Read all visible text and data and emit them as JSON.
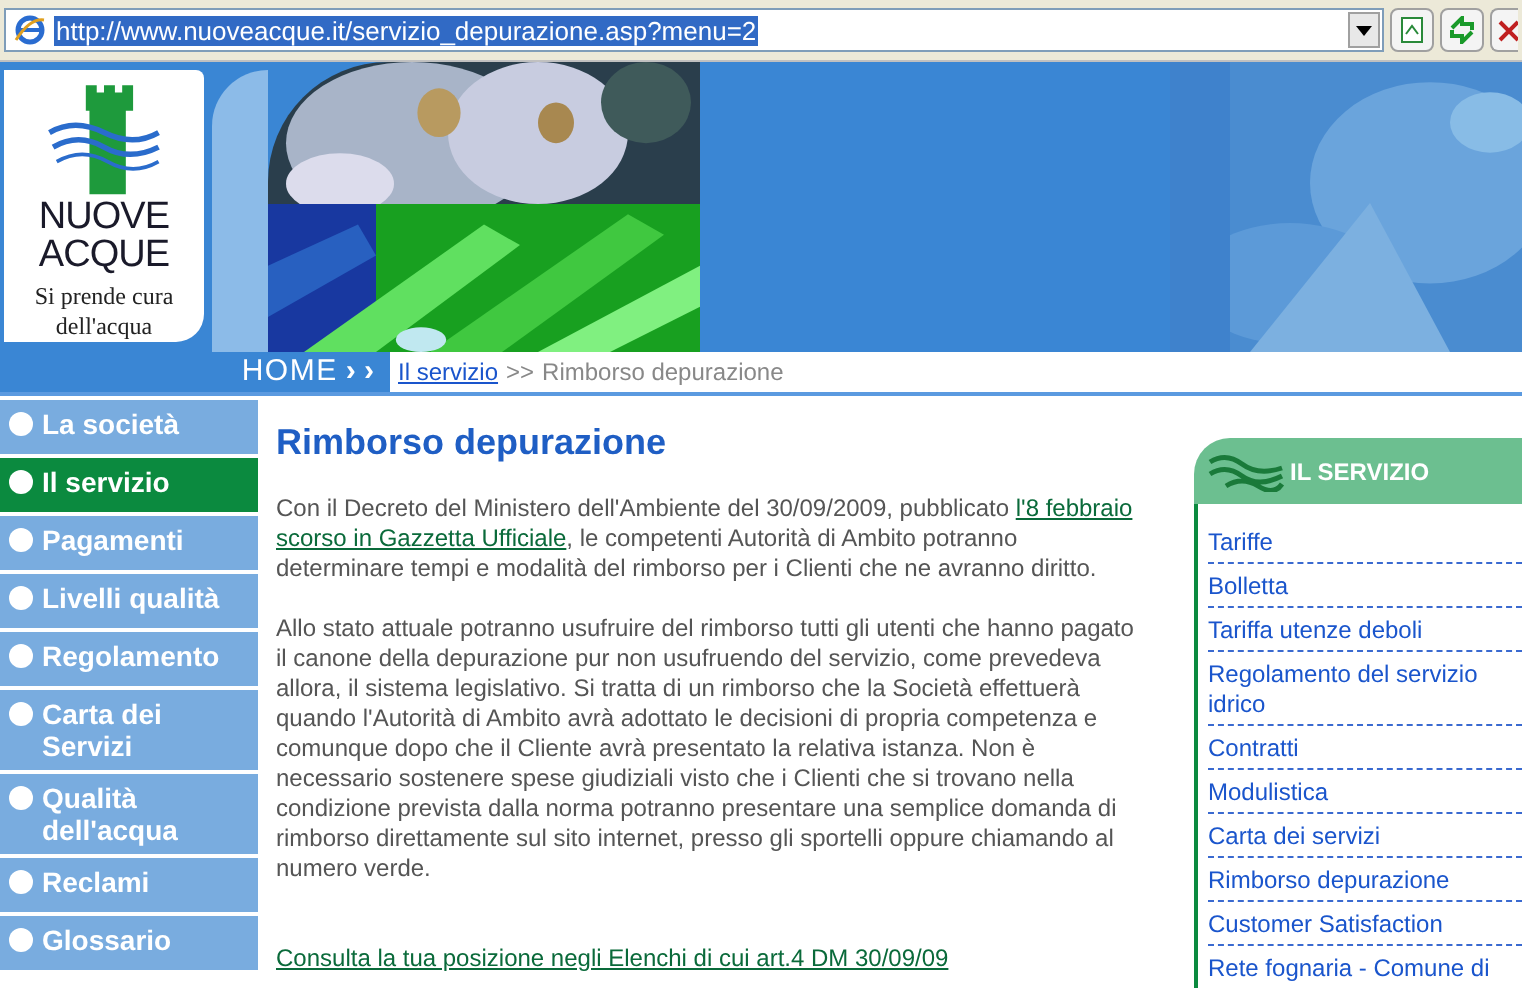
{
  "address_bar": {
    "url": "http://www.nuoveacque.it/servizio_depurazione.asp?menu=2"
  },
  "logo": {
    "name_lines": [
      "NUOVE",
      "ACQUE"
    ],
    "tagline_lines": [
      "Si prende cura",
      "dell'acqua"
    ]
  },
  "home_bar": {
    "label": "HOME",
    "arrows": "› ›"
  },
  "breadcrumb": {
    "link": "Il servizio",
    "separator": ">>",
    "current": "Rimborso depurazione"
  },
  "sidebar": {
    "items": [
      {
        "label": "La società",
        "selected": false
      },
      {
        "label": "Il servizio",
        "selected": true
      },
      {
        "label": "Pagamenti",
        "selected": false
      },
      {
        "label": "Livelli qualità",
        "selected": false
      },
      {
        "label": "Regolamento",
        "selected": false
      },
      {
        "label": "Carta dei Servizi",
        "selected": false
      },
      {
        "label": "Qualità dell'acqua",
        "selected": false
      },
      {
        "label": "Reclami",
        "selected": false
      },
      {
        "label": "Glossario",
        "selected": false
      }
    ]
  },
  "main": {
    "title": "Rimborso depurazione",
    "paragraph_1": {
      "before": "Con il Decreto del Ministero dell'Ambiente del 30/09/2009, pubblicato",
      "link_lines": [
        "l'8 febbraio",
        "scorso in Gazzetta Ufficiale"
      ],
      "after": ", le competenti Autorità di Ambito potranno determinare tempi e modalità del rimborso per i Clienti che ne avranno diritto."
    },
    "paragraph_2": "Allo stato attuale potranno usufruire del rimborso tutti gli utenti che hanno pagato il canone della depurazione pur non usufruendo del servizio, come prevedeva allora, il sistema legislativo. Si tratta di un rimborso che la Società effettuerà quando l'Autorità di Ambito avrà adottato le decisioni di propria competenza e comunque dopo che il Cliente avrà presentato la relativa istanza. Non è necessario sostenere spese giudiziali visto che i Clienti che si trovano nella condizione prevista dalla norma potranno presentare una semplice domanda di rimborso direttamente sul sito internet, presso gli sportelli oppure chiamando al numero verde.",
    "bottom_link": "Consulta la tua posizione negli Elenchi di cui art.4 DM 30/09/09"
  },
  "right_panel": {
    "title": "IL SERVIZIO",
    "links": [
      "Tariffe",
      "Bolletta",
      "Tariffa utenze deboli",
      "Regolamento del servizio idrico",
      "Contratti",
      "Modulistica",
      "Carta dei servizi",
      "Rimborso depurazione",
      "Customer Satisfaction",
      "Rete fognaria - Comune di"
    ]
  }
}
